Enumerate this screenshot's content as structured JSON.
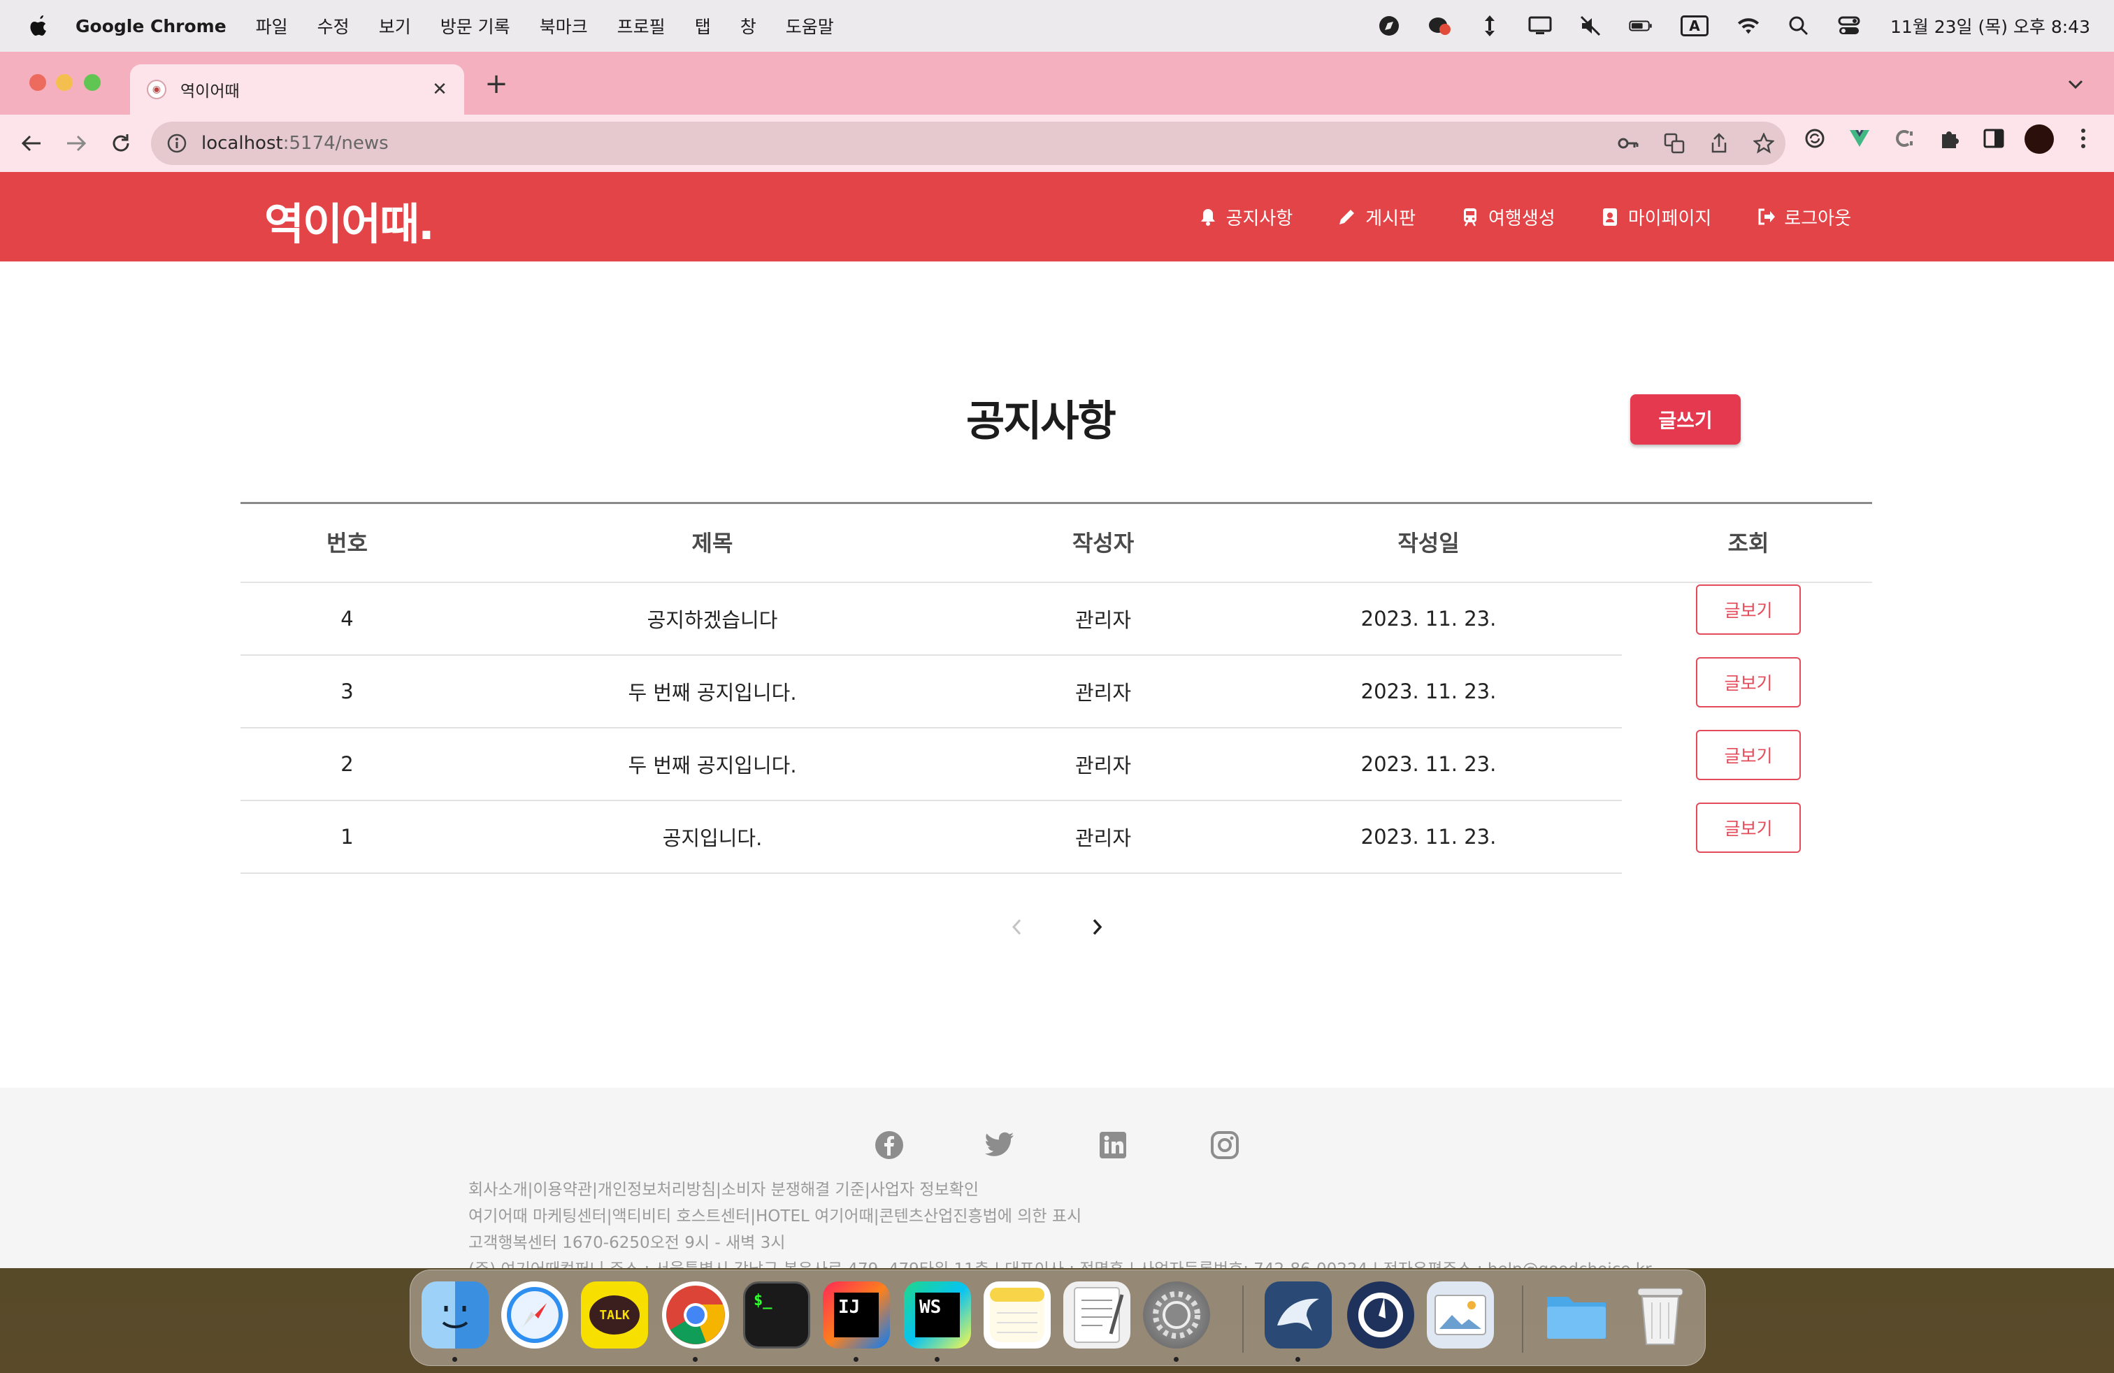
{
  "menubar": {
    "app_name": "Google Chrome",
    "items": [
      "파일",
      "수정",
      "보기",
      "방문 기록",
      "북마크",
      "프로필",
      "탭",
      "창",
      "도움말"
    ],
    "clock": "11월 23일 (목) 오후 8:43",
    "input_source": "A",
    "status_icons": [
      "compass-icon",
      "kakao-notification-icon",
      "arrows-icon",
      "display-icon",
      "mute-icon",
      "battery-icon",
      "input-source-icon",
      "wifi-icon",
      "spotlight-icon",
      "control-center-icon"
    ]
  },
  "browser": {
    "tab_title": "역이어때",
    "url_host": "localhost",
    "url_path": ":5174/news"
  },
  "site": {
    "logo": "역이어때.",
    "nav": [
      {
        "label": "공지사항",
        "icon": "bell-icon"
      },
      {
        "label": "게시판",
        "icon": "pencil-icon"
      },
      {
        "label": "여행생성",
        "icon": "train-icon"
      },
      {
        "label": "마이페이지",
        "icon": "id-badge-icon"
      },
      {
        "label": "로그아웃",
        "icon": "logout-icon"
      }
    ]
  },
  "notice": {
    "title": "공지사항",
    "write_label": "글쓰기",
    "columns": [
      "번호",
      "제목",
      "작성자",
      "작성일",
      "조회"
    ],
    "view_label": "글보기",
    "rows": [
      {
        "no": "4",
        "title": "공지하겠습니다",
        "author": "관리자",
        "date": "2023. 11. 23."
      },
      {
        "no": "3",
        "title": "두 번째 공지입니다.",
        "author": "관리자",
        "date": "2023. 11. 23."
      },
      {
        "no": "2",
        "title": "두 번째 공지입니다.",
        "author": "관리자",
        "date": "2023. 11. 23."
      },
      {
        "no": "1",
        "title": "공지입니다.",
        "author": "관리자",
        "date": "2023. 11. 23."
      }
    ]
  },
  "footer": {
    "social": [
      "facebook-icon",
      "twitter-icon",
      "linkedin-icon",
      "instagram-icon"
    ],
    "lines": [
      "회사소개|이용약관|개인정보처리방침|소비자 분쟁해결 기준|사업자 정보확인",
      "여기어때 마케팅센터|액티비티 호스트센터|HOTEL 여기어때|콘텐츠산업진흥법에 의한 표시",
      "고객행복센터 1670-6250오전 9시 - 새벽 3시",
      "(주) 여기어때컴퍼니 주소 : 서울특별시 강남구 봉은사로 479, 479타워 11층 | 대표이사 : 정명훈 | 사업자등록번호: 742-86-00224 | 전자우편주소 : help@goodchoice.kr"
    ]
  },
  "dock": {
    "apps": [
      {
        "name": "Finder",
        "icon": "finder-icon"
      },
      {
        "name": "Safari",
        "icon": "safari-icon"
      },
      {
        "name": "KakaoTalk",
        "icon": "kakaotalk-icon",
        "label": "TALK"
      },
      {
        "name": "Chrome",
        "icon": "chrome-icon"
      },
      {
        "name": "Terminal",
        "icon": "terminal-icon",
        "label": "$_"
      },
      {
        "name": "IntelliJ IDEA",
        "icon": "intellij-icon",
        "label": "IJ"
      },
      {
        "name": "WebStorm",
        "icon": "webstorm-icon",
        "label": "WS"
      },
      {
        "name": "Notes",
        "icon": "notes-icon"
      },
      {
        "name": "TextEdit",
        "icon": "textedit-icon"
      },
      {
        "name": "System Settings",
        "icon": "settings-icon"
      },
      {
        "name": "MySQL Workbench",
        "icon": "mysql-workbench-icon"
      },
      {
        "name": "Mattermost",
        "icon": "mattermost-icon"
      },
      {
        "name": "Preview",
        "icon": "preview-icon"
      },
      {
        "name": "Downloads",
        "icon": "folder-icon"
      },
      {
        "name": "Trash",
        "icon": "trash-icon"
      }
    ]
  },
  "colors": {
    "brand": "#e34447",
    "tab_strip": "#f4b0be",
    "toolbar": "#fce4ea",
    "write_button": "#e53950"
  }
}
